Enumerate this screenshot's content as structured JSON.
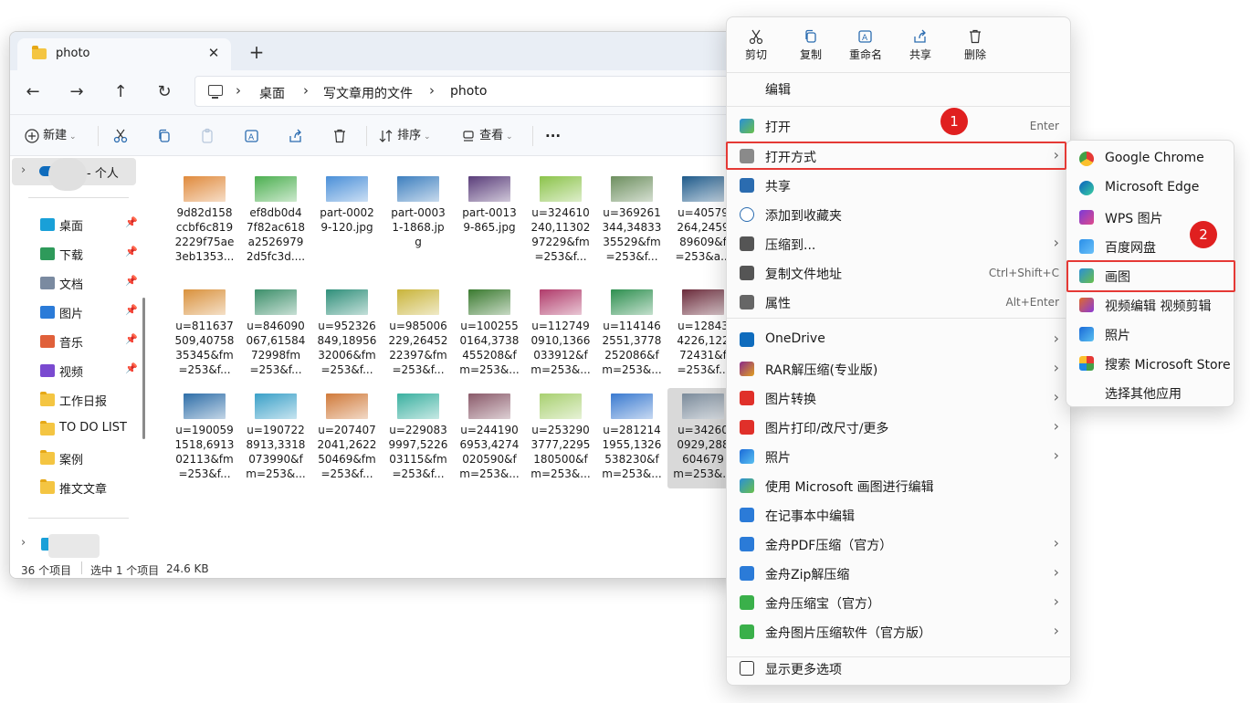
{
  "window": {
    "tab_title": "photo",
    "tab_close": "✕",
    "new_tab": "+"
  },
  "nav": {
    "back": "←",
    "forward": "→",
    "up": "↑",
    "refresh": "↻",
    "breadcrumbs": [
      "桌面",
      "写文章用的文件",
      "photo"
    ],
    "sep": "›"
  },
  "toolbar": {
    "new_label": "新建",
    "sort_label": "排序",
    "view_label": "查看",
    "more_label": "···"
  },
  "sidebar": {
    "onedrive_label": "- 个人",
    "items": [
      {
        "label": "桌面",
        "icon": "desktop-icon",
        "pinned": true
      },
      {
        "label": "下载",
        "icon": "download-icon",
        "pinned": true
      },
      {
        "label": "文档",
        "icon": "document-icon",
        "pinned": true
      },
      {
        "label": "图片",
        "icon": "picture-icon",
        "pinned": true
      },
      {
        "label": "音乐",
        "icon": "music-icon",
        "pinned": true
      },
      {
        "label": "视频",
        "icon": "video-icon",
        "pinned": true
      },
      {
        "label": "工作日报",
        "icon": "folder-icon",
        "pinned": false
      },
      {
        "label": "TO DO LIST",
        "icon": "folder-icon",
        "pinned": false
      },
      {
        "label": "案例",
        "icon": "folder-icon",
        "pinned": false
      },
      {
        "label": "推文文章",
        "icon": "folder-icon",
        "pinned": false
      }
    ],
    "pin_glyph": "📌"
  },
  "files": [
    {
      "lines": [
        "9d82d158",
        "ccbf6c819",
        "2229f75ae",
        "3eb1353..."
      ],
      "color": "#e08a3c"
    },
    {
      "lines": [
        "ef8db0d4",
        "7f82ac618",
        "a2526979",
        "2d5fc3d...."
      ],
      "color": "#4caf50"
    },
    {
      "lines": [
        "part-0002",
        "9-120.jpg"
      ],
      "color": "#4a8fd8"
    },
    {
      "lines": [
        "part-0003",
        "1-1868.jp",
        "g"
      ],
      "color": "#3d7fbf"
    },
    {
      "lines": [
        "part-0013",
        "9-865.jpg"
      ],
      "color": "#5a3d7a"
    },
    {
      "lines": [
        "u=324610",
        "240,11302",
        "97229&fm",
        "=253&f..."
      ],
      "color": "#8bc34a"
    },
    {
      "lines": [
        "u=369261",
        "344,34833",
        "35529&fm",
        "=253&f..."
      ],
      "color": "#6d8f5f"
    },
    {
      "lines": [
        "u=40579",
        "264,2459",
        "89609&f",
        "=253&a..."
      ],
      "color": "#1e5a8a"
    },
    {
      "lines": [
        "u=811637",
        "509,40758",
        "35345&fm",
        "=253&f..."
      ],
      "color": "#d9913c"
    },
    {
      "lines": [
        "u=846090",
        "067,61584",
        "72998fm",
        "=253&f..."
      ],
      "color": "#3c8f6a"
    },
    {
      "lines": [
        "u=952326",
        "849,18956",
        "32006&fm",
        "=253&f..."
      ],
      "color": "#2f8f7a"
    },
    {
      "lines": [
        "u=985006",
        "229,26452",
        "22397&fm",
        "=253&f..."
      ],
      "color": "#c9b43a"
    },
    {
      "lines": [
        "u=100255",
        "0164,3738",
        "455208&f",
        "m=253&..."
      ],
      "color": "#3a7a2f"
    },
    {
      "lines": [
        "u=112749",
        "0910,1366",
        "033912&f",
        "m=253&..."
      ],
      "color": "#b03a6a"
    },
    {
      "lines": [
        "u=114146",
        "2551,3778",
        "252086&f",
        "m=253&..."
      ],
      "color": "#2d8f4f"
    },
    {
      "lines": [
        "u=12843",
        "4226,122",
        "72431&f",
        "=253&f..."
      ],
      "color": "#6a2a3a"
    },
    {
      "lines": [
        "u=190059",
        "1518,6913",
        "02113&fm",
        "=253&f..."
      ],
      "color": "#2e6ea8"
    },
    {
      "lines": [
        "u=190722",
        "8913,3318",
        "073990&f",
        "m=253&..."
      ],
      "color": "#3aa0c8"
    },
    {
      "lines": [
        "u=207407",
        "2041,2622",
        "50469&fm",
        "=253&f..."
      ],
      "color": "#d07a3a"
    },
    {
      "lines": [
        "u=229083",
        "9997,5226",
        "03115&fm",
        "=253&f..."
      ],
      "color": "#3ab0a0"
    },
    {
      "lines": [
        "u=244190",
        "6953,4274",
        "020590&f",
        "m=253&..."
      ],
      "color": "#8a5a6a"
    },
    {
      "lines": [
        "u=253290",
        "3777,2295",
        "180500&f",
        "m=253&..."
      ],
      "color": "#a8d070"
    },
    {
      "lines": [
        "u=281214",
        "1955,1326",
        "538230&f",
        "m=253&..."
      ],
      "color": "#3a7ad0"
    },
    {
      "lines": [
        "u=34260",
        "0929,288",
        "604679",
        "m=253&..."
      ],
      "color": "#7a8a9a",
      "selected": true
    }
  ],
  "status": {
    "count": "36 个项目",
    "selected": "选中 1 个项目",
    "size": "24.6 KB"
  },
  "context_menu": {
    "quick_actions": [
      {
        "label": "剪切",
        "icon": "cut-icon"
      },
      {
        "label": "复制",
        "icon": "copy-icon"
      },
      {
        "label": "重命名",
        "icon": "rename-icon"
      },
      {
        "label": "共享",
        "icon": "share-icon"
      },
      {
        "label": "删除",
        "icon": "delete-icon"
      }
    ],
    "edit": "编辑",
    "items": [
      {
        "label": "打开",
        "shortcut": "Enter",
        "icon": "paint-icon",
        "arrow": false
      },
      {
        "label": "打开方式",
        "shortcut": "",
        "icon": "open-with-icon",
        "arrow": true,
        "highlight": true
      },
      {
        "label": "共享",
        "shortcut": "",
        "icon": "share-icon",
        "arrow": false
      },
      {
        "label": "添加到收藏夹",
        "shortcut": "",
        "icon": "star-icon",
        "arrow": false
      },
      {
        "label": "压缩到...",
        "shortcut": "",
        "icon": "zip-icon",
        "arrow": true
      },
      {
        "label": "复制文件地址",
        "shortcut": "Ctrl+Shift+C",
        "icon": "path-icon",
        "arrow": false
      },
      {
        "label": "属性",
        "shortcut": "Alt+Enter",
        "icon": "wrench-icon",
        "arrow": false
      },
      {
        "label": "OneDrive",
        "shortcut": "",
        "icon": "onedrive-icon",
        "arrow": true
      },
      {
        "label": "RAR解压缩(专业版)",
        "shortcut": "",
        "icon": "rar-icon",
        "arrow": true
      },
      {
        "label": "图片转换",
        "shortcut": "",
        "icon": "wps-icon",
        "arrow": true
      },
      {
        "label": "图片打印/改尺寸/更多",
        "shortcut": "",
        "icon": "wps-icon",
        "arrow": true
      },
      {
        "label": "照片",
        "shortcut": "",
        "icon": "photos-icon",
        "arrow": true
      },
      {
        "label": "使用 Microsoft 画图进行编辑",
        "shortcut": "",
        "icon": "paint-icon",
        "arrow": false
      },
      {
        "label": "在记事本中编辑",
        "shortcut": "",
        "icon": "notepad-icon",
        "arrow": false
      },
      {
        "label": "金舟PDF压缩（官方）",
        "shortcut": "",
        "icon": "jz-pdf-icon",
        "arrow": true
      },
      {
        "label": "金舟Zip解压缩",
        "shortcut": "",
        "icon": "jz-zip-icon",
        "arrow": true
      },
      {
        "label": "金舟压缩宝（官方）",
        "shortcut": "",
        "icon": "jz-compress-icon",
        "arrow": true
      },
      {
        "label": "金舟图片压缩软件（官方版）",
        "shortcut": "",
        "icon": "jz-image-icon",
        "arrow": true
      }
    ],
    "more": "显示更多选项",
    "arrow_glyph": "›"
  },
  "submenu": {
    "items": [
      {
        "label": "Google Chrome",
        "icon": "chrome-icon"
      },
      {
        "label": "Microsoft Edge",
        "icon": "edge-icon"
      },
      {
        "label": "WPS 图片",
        "icon": "wps-pic-icon"
      },
      {
        "label": "百度网盘",
        "icon": "baidu-icon"
      },
      {
        "label": "画图",
        "icon": "paint-icon",
        "highlight": true
      },
      {
        "label": "视频编辑 视频剪辑",
        "icon": "video-edit-icon"
      },
      {
        "label": "照片",
        "icon": "photos-icon"
      },
      {
        "label": "搜索 Microsoft Store",
        "icon": "store-icon"
      },
      {
        "label": "选择其他应用",
        "icon": ""
      }
    ]
  },
  "annotations": {
    "badge1": "1",
    "badge2": "2"
  },
  "colors": {
    "highlight": "#e53935",
    "accent": "#0067c0"
  }
}
